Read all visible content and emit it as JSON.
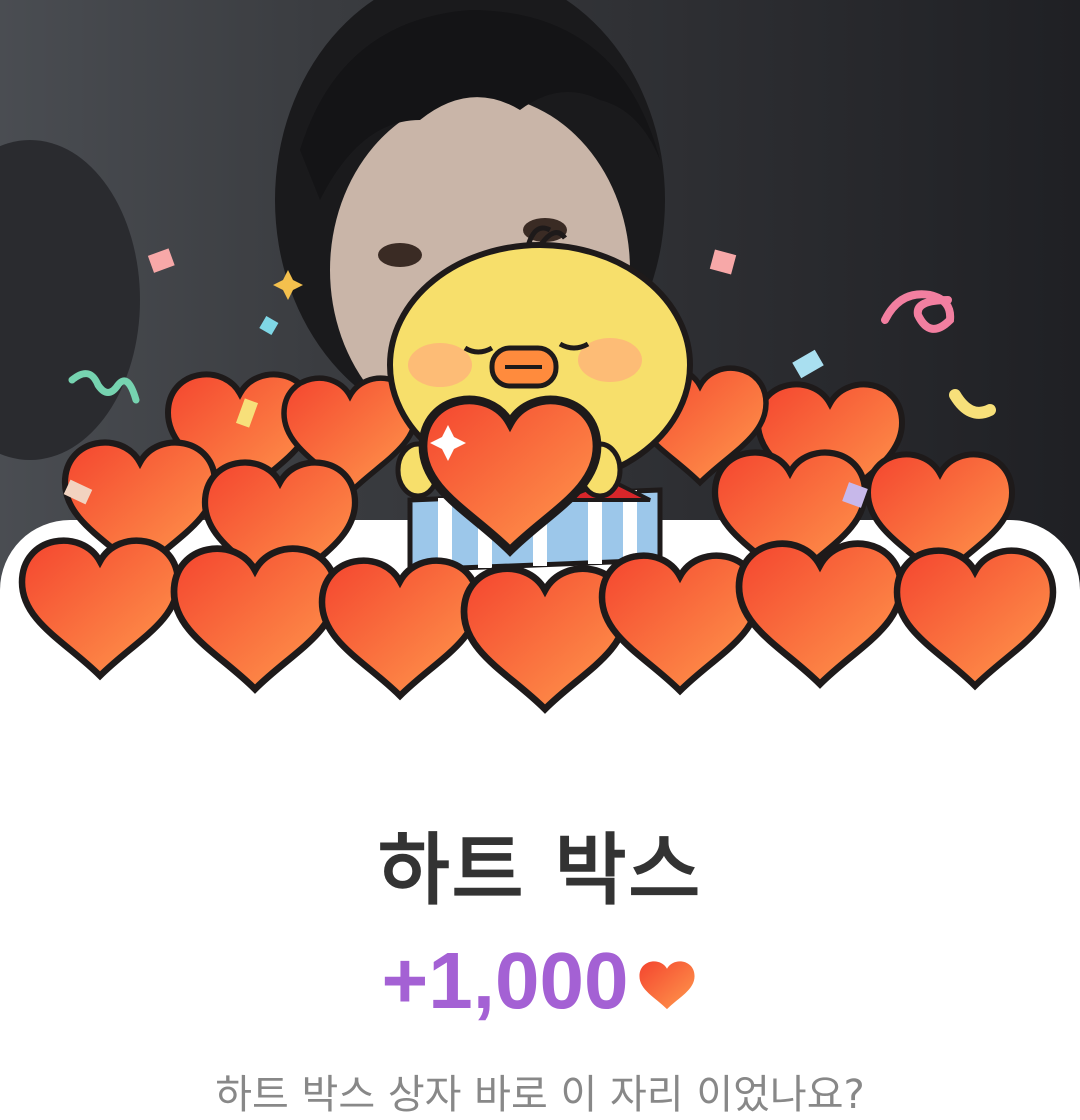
{
  "popup": {
    "title": "하트 박스",
    "reward_amount": "+1,000",
    "reward_icon": "heart-icon",
    "description": "하트 박스 상자 바로 이 자리 이었나요?"
  },
  "illustration": {
    "character": "yellow-chick-icon",
    "heart_count": 18
  },
  "colors": {
    "accent_purple": "#a461d4",
    "heart_top": "#f4452f",
    "heart_bottom": "#ff9a4d",
    "chick": "#f7df6b"
  }
}
